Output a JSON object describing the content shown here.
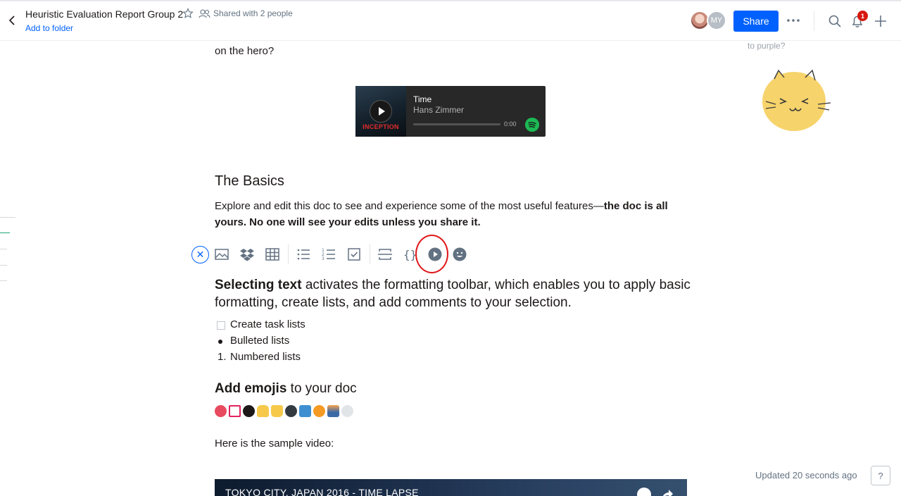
{
  "header": {
    "title": "Heuristic Evaluation Report Group 2",
    "shared_label": "Shared with 2 people",
    "add_to_folder": "Add to folder",
    "avatar_initials": "MY",
    "share_button": "Share",
    "notification_count": "1"
  },
  "document": {
    "cut_line_text": "on the hero?",
    "spotify": {
      "track": "Time",
      "artist": "Hans Zimmer",
      "time": "0:00",
      "art_label": "INCEPTION"
    },
    "basics_heading": "The Basics",
    "explore_text": "Explore and edit this doc to see and experience some of the most useful features—",
    "explore_bold": "the doc is all yours. No one will see your edits unless you share it.",
    "select_bold": "Selecting text",
    "select_text": " activates the formatting toolbar, which enables you to apply basic formatting, create lists, and add comments to your selection.",
    "list_items": [
      {
        "marker": "checkbox",
        "text": "Create task lists"
      },
      {
        "marker": "bullet",
        "text": "Bulleted lists"
      },
      {
        "marker": "1.",
        "text": "Numbered lists"
      }
    ],
    "emoji_heading_bold": "Add emojis",
    "emoji_heading_rest": " to your doc",
    "emojis": [
      "heart-arrow",
      "hundred",
      "eight-ball",
      "thumb-up",
      "thumb-down",
      "spy",
      "t-shirt",
      "tangerine",
      "sunrise",
      "speech-balloon"
    ],
    "sample_video_label": "Here is the sample video:",
    "video_title": "TOKYO CITY, JAPAN 2016 - TIME LAPSE"
  },
  "toolbar": {
    "icons": [
      "image-icon",
      "dropbox-icon",
      "table-icon",
      "bulleted-list-icon",
      "numbered-list-icon",
      "checklist-icon",
      "divider-icon",
      "code-icon",
      "media-play-icon",
      "emoji-icon"
    ],
    "highlighted": "media-play-icon"
  },
  "sidebar": {
    "comment_snippet": "to purple?"
  },
  "footer": {
    "updated": "Updated 20 seconds ago",
    "help": "?"
  },
  "colors": {
    "accent": "#0061fe",
    "highlight_circle": "#e0181a",
    "spotify_green": "#1db954",
    "badge_red": "#d6190f"
  }
}
